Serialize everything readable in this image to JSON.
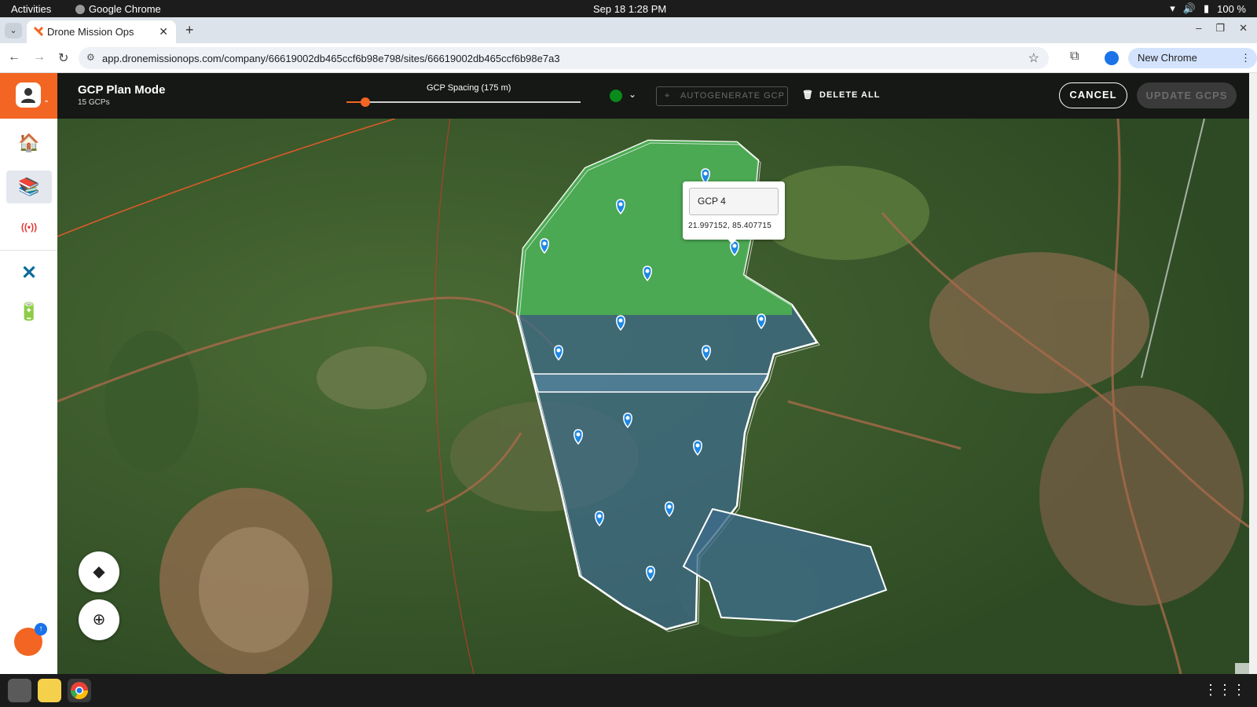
{
  "os": {
    "activities": "Activities",
    "app_name": "Google Chrome",
    "clock": "Sep 18  1:28 PM",
    "battery": "100 %"
  },
  "browser": {
    "tab_title": "Drone Mission Ops",
    "url": "app.dronemissionops.com/company/66619002db465ccf6b98e798/sites/66619002db465ccf6b98e7a3",
    "new_chrome": "New Chrome available"
  },
  "header": {
    "mode_title": "GCP Plan Mode",
    "gcp_count": "15 GCPs",
    "spacing_label": "GCP Spacing (175 m)",
    "spacing_fraction": 0.08,
    "status_color": "#0a8a1a",
    "autogenerate_label": "AUTOGENERATE GCP",
    "delete_all_label": "DELETE ALL",
    "cancel_label": "CANCEL",
    "update_label": "UPDATE GCPS"
  },
  "sidebar": {
    "items": [
      {
        "name": "home-icon",
        "glyph": "🏠"
      },
      {
        "name": "sites-icon",
        "glyph": "📚"
      },
      {
        "name": "live-icon",
        "glyph": "((•))"
      },
      {
        "name": "drone-icon",
        "glyph": "✕"
      },
      {
        "name": "battery-icon",
        "glyph": "🔋"
      }
    ]
  },
  "popup": {
    "gcp_name": "GCP 4",
    "coords": "21.997152, 85.407715"
  },
  "colors": {
    "brand": "#f26522",
    "accent": "#1a73e8",
    "polygon_green": "#4caf50",
    "polygon_blue": "#3d6b8a"
  }
}
